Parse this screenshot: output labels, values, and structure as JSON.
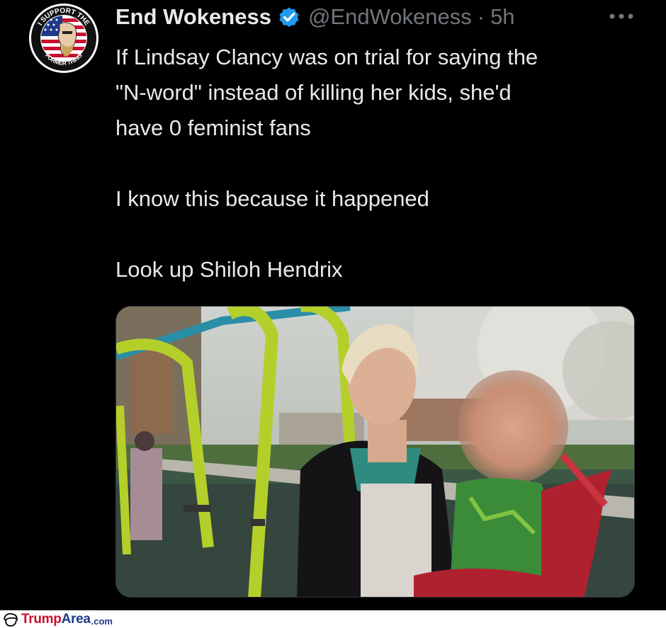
{
  "tweet": {
    "display_name": "End Wokeness",
    "verified_icon": "verified-badge-icon",
    "handle": "@EndWokeness",
    "separator": "·",
    "time": "5h",
    "more_icon": "more-options-icon",
    "avatar_icon": "profile-avatar",
    "avatar_text_top": "I SUPPORT THE",
    "avatar_text_bottom": "FORMER THING",
    "text_lines": [
      "If Lindsay Clancy was on trial for saying the",
      "\"N-word\" instead of killing her kids, she'd",
      "have 0 feminist fans"
    ],
    "text_para2": "I know this because it happened",
    "text_para3": "Look up Shiloh Hendrix",
    "media_icon": "attached-photo",
    "colors": {
      "background": "#000000",
      "primary_text": "#e7e9ea",
      "secondary_text": "#71767b",
      "verified_blue": "#1d9bf0"
    }
  },
  "watermark": {
    "icon": "trump-hair-icon",
    "brand_part1": "Trump",
    "brand_part2": "Area",
    "brand_part3": ".com"
  }
}
